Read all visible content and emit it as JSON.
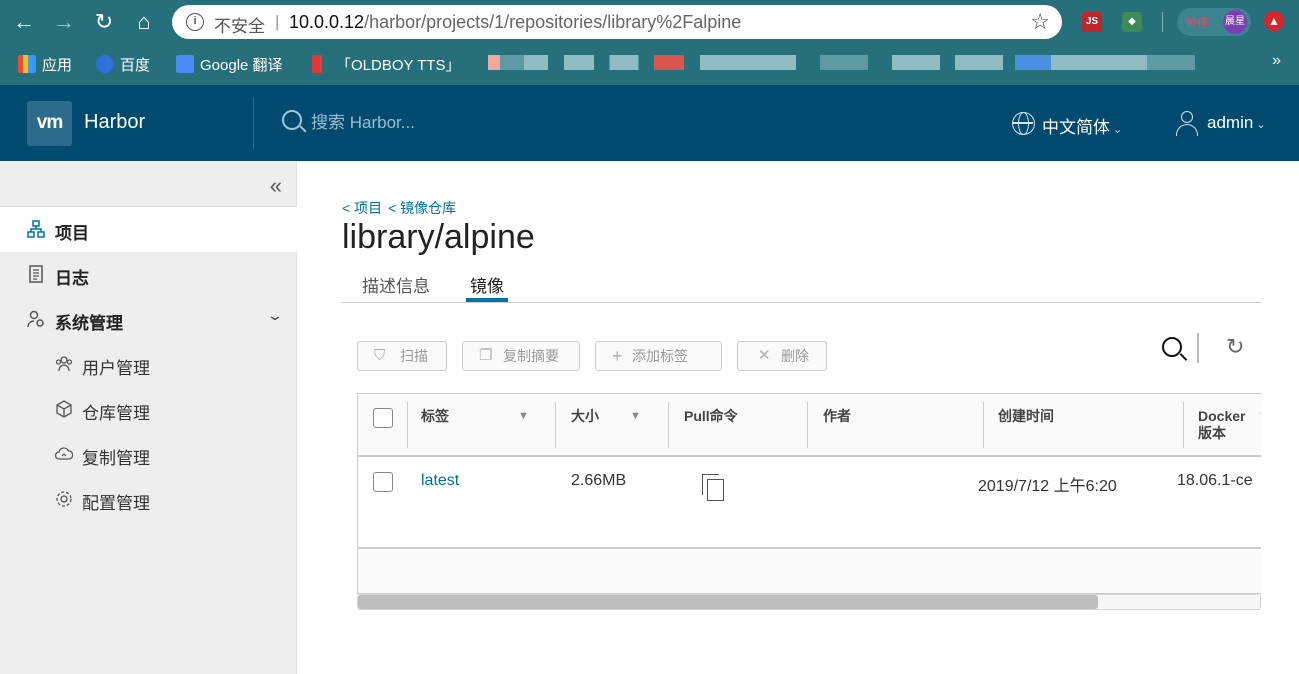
{
  "browser": {
    "nav": {
      "back": "←",
      "forward": "→",
      "reload": "↻",
      "home": "⌂"
    },
    "omnibox": {
      "insecure_label": "不安全",
      "separator": "|",
      "url_host": "10.0.0.12",
      "url_path": "/harbor/projects/1/repositories/library%2Falpine"
    },
    "extensions": {
      "js_label": "JS",
      "avatar_label": "晨星",
      "pill_label": "暂停"
    },
    "bookmarks": [
      {
        "label": "应用",
        "color": "#e8a33c"
      },
      {
        "label": "百度",
        "color": "#2f6fdc"
      },
      {
        "label": "Google 翻译",
        "color": "#4a8af4"
      },
      {
        "label": "「OLDBOY TTS」",
        "color": "#e53935"
      }
    ],
    "more": "»"
  },
  "header": {
    "logo_text": "vm",
    "app_name": "Harbor",
    "search_placeholder": "搜索 Harbor...",
    "language": "中文简体",
    "user": "admin",
    "caret": "⌄"
  },
  "sidebar": {
    "collapse": "«",
    "items": [
      {
        "label": "项目"
      },
      {
        "label": "日志"
      },
      {
        "label": "系统管理"
      }
    ],
    "sub_items": [
      {
        "label": "用户管理"
      },
      {
        "label": "仓库管理"
      },
      {
        "label": "复制管理"
      },
      {
        "label": "配置管理"
      }
    ]
  },
  "main": {
    "breadcrumb": [
      "< 项目",
      "< 镜像仓库"
    ],
    "title": "library/alpine",
    "tabs": [
      {
        "label": "描述信息",
        "active": false
      },
      {
        "label": "镜像",
        "active": true
      }
    ],
    "toolbar": {
      "scan": "扫描",
      "copy_digest": "复制摘要",
      "add_label": "添加标签",
      "delete": "删除"
    },
    "table": {
      "columns": [
        "标签",
        "大小",
        "Pull命令",
        "作者",
        "创建时间",
        "Docker",
        "版本"
      ],
      "rows": [
        {
          "tag": "latest",
          "size": "2.66MB",
          "author": "",
          "created": "2019/7/12 上午6:20",
          "docker_version": "18.06.1-ce"
        }
      ]
    },
    "scroll_fraction": 0.82
  },
  "colors": {
    "browser_chrome": "#26707c",
    "header": "#004a70",
    "link": "#0072a3",
    "sidebar": "#eeeeee"
  }
}
